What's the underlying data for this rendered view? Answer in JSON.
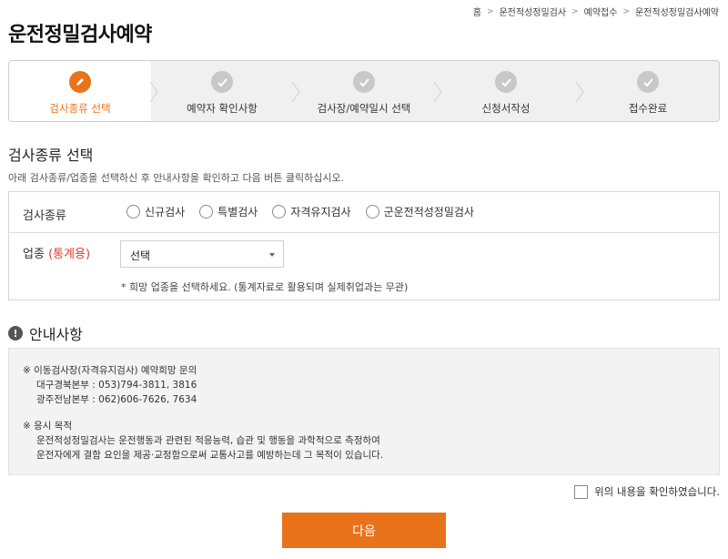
{
  "breadcrumb": [
    "홈",
    "운전적성정밀검사",
    "예약접수",
    "운전적성정밀검사예약"
  ],
  "page_title": "운전정밀검사예약",
  "steps": [
    {
      "label": "검사종류 선택",
      "state": "active",
      "icon": "pencil-icon"
    },
    {
      "label": "예약자 확인사항",
      "state": "done",
      "icon": "check-icon"
    },
    {
      "label": "검사장/예약일시 선택",
      "state": "done",
      "icon": "check-icon"
    },
    {
      "label": "신청서작성",
      "state": "done",
      "icon": "check-icon"
    },
    {
      "label": "접수완료",
      "state": "done",
      "icon": "check-icon"
    }
  ],
  "section": {
    "title": "검사종류 선택",
    "description": "아래 검사종류/업종을 선택하신 후 안내사항을 확인하고 다음 버튼 클릭하십시오."
  },
  "form": {
    "exam_type_label": "검사종류",
    "exam_options": [
      "신규검사",
      "특별검사",
      "자격유지검사",
      "군운전적성정밀검사"
    ],
    "industry_label": "업종",
    "industry_note": "(통계용)",
    "industry_select_value": "선택",
    "industry_hint": "* 희망 업종을 선택하세요. (통계자료로 활용되며 실제취업과는 무관)"
  },
  "notice": {
    "title": "안내사항",
    "block1_title": "※ 이동검사장(자격유지검사) 예약희망 문의",
    "block1_lines": [
      "대구경북본부 : 053)794-3811, 3816",
      "광주전남본부 : 062)606-7626, 7634"
    ],
    "block2_title": "※ 응시 목적",
    "block2_lines": [
      "운전적성정밀검사는 운전행동과 관련된 적응능력, 습관 및 행동을 과학적으로 측정하여",
      "운전자에게 결함 요인을 제공·교정함으로써 교통사고를 예방하는데 그 목적이 있습니다."
    ]
  },
  "confirm_label": "위의 내용을 확인하였습니다.",
  "next_button": "다음",
  "colors": {
    "accent": "#e8731a",
    "required": "#e53b2a",
    "done": "#c8c8c8"
  }
}
